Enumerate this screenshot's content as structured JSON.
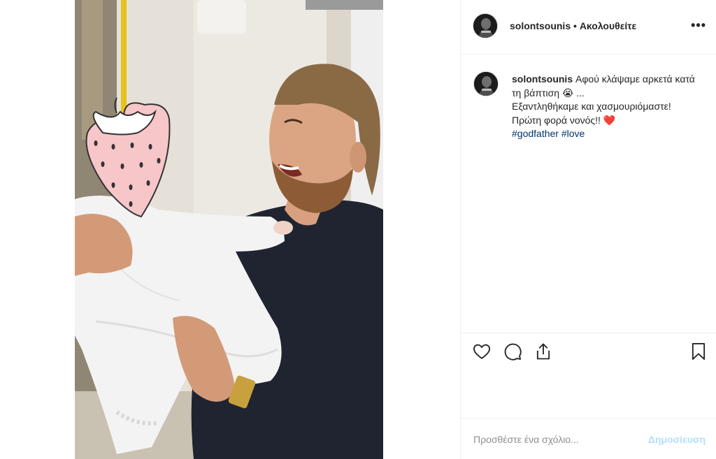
{
  "post": {
    "username": "solontsounis",
    "separator": "•",
    "follow_state": "Ακολουθείτε",
    "more_label": "•••"
  },
  "caption": {
    "username": "solontsounis",
    "line1": "Αφού κλάψαμε αρκετά κατά τη βάπτιση",
    "emoji_cry": "😭",
    "ellipsis": "...",
    "line2": "Εξαντληθήκαμε και χασμουριόμαστε!",
    "line3": "Πρώτη φορά νονός!!",
    "emoji_heart": "❤️",
    "hashtag1": "#godfather",
    "hashtag2": "#love"
  },
  "actions": {
    "like_icon": "heart-outline-icon",
    "comment_icon": "comment-bubble-icon",
    "share_icon": "share-upload-icon",
    "save_icon": "bookmark-icon"
  },
  "comment": {
    "placeholder": "Προσθέστε ένα σχόλιο...",
    "publish_label": "Δημοσίευση"
  },
  "colors": {
    "hashtag": "#003569",
    "publish_disabled": "#b2dffc",
    "border": "#efefef",
    "strawberry": "#f7c6c9"
  }
}
